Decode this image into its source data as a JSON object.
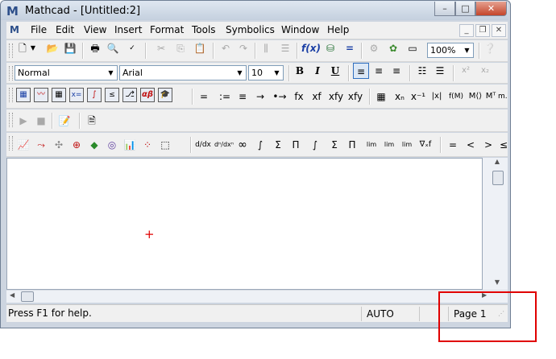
{
  "window": {
    "title": "Mathcad - [Untitled:2]",
    "app_icon": "M"
  },
  "caption_buttons": {
    "minimize": "–",
    "maximize": "□",
    "close": "✕"
  },
  "menu": {
    "items": [
      "File",
      "Edit",
      "View",
      "Insert",
      "Format",
      "Tools",
      "Symbolics",
      "Window",
      "Help"
    ],
    "mdi_minimize": "_",
    "mdi_restore": "❐",
    "mdi_close": "✕"
  },
  "standard_toolbar": {
    "zoom": "100%"
  },
  "format_toolbar": {
    "style": "Normal",
    "font": "Arial",
    "size": "10",
    "bold": "B",
    "italic": "I",
    "underline": "U"
  },
  "math_toolbar": {
    "ops": [
      "=",
      ":=",
      "≡",
      "→",
      "•→",
      "fx",
      "xf",
      "xfy",
      "xfy"
    ],
    "vector_ops": [
      "xₙ",
      "x⁻¹",
      "|x|",
      "f(M)",
      "M⟨⟩",
      "Mᵀ",
      "m.."
    ]
  },
  "calculus_toolbar": {
    "ops": [
      "d/dx",
      "dⁿ/dxⁿ",
      "∞",
      "∫",
      "Σ",
      "Π",
      "∫",
      "Σ",
      "Π",
      "lim",
      "lim",
      "lim",
      "∇ₓf"
    ],
    "bool_ops": [
      "=",
      "<",
      ">",
      "≤"
    ]
  },
  "statusbar": {
    "help": "Press F1 for help.",
    "mode": "AUTO",
    "page": "Page 1"
  }
}
